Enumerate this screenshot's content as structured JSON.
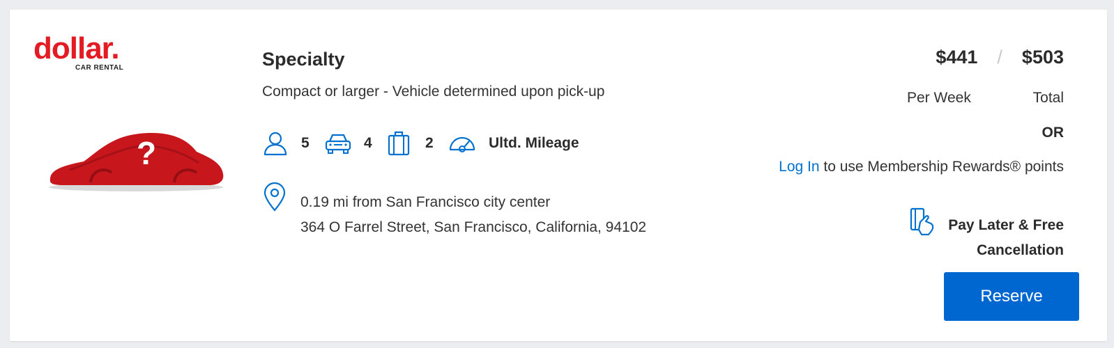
{
  "brand": {
    "name": "dollar.",
    "tagline": "CAR RENTAL",
    "color": "#e31b23"
  },
  "vehicle": {
    "category": "Specialty",
    "description": "Compact or larger - Vehicle determined upon pick-up",
    "image_icon": "covered-car-question-mark"
  },
  "features": {
    "passengers": "5",
    "doors": "4",
    "bags": "2",
    "mileage": "Ultd. Mileage"
  },
  "location": {
    "distance": "0.19 mi from San Francisco city center",
    "address": "364 O Farrel Street, San Francisco, California, 94102"
  },
  "pricing": {
    "weekly": "$441",
    "separator": "/",
    "total": "$503",
    "weekly_label": "Per Week",
    "total_label": "Total",
    "or_label": "OR",
    "login_link": "Log In",
    "rewards_text": " to use Membership Rewards® points",
    "pay_later": "Pay Later & Free Cancellation"
  },
  "actions": {
    "reserve_label": "Reserve"
  },
  "colors": {
    "accent": "#0071ce",
    "button": "#0067d0"
  }
}
